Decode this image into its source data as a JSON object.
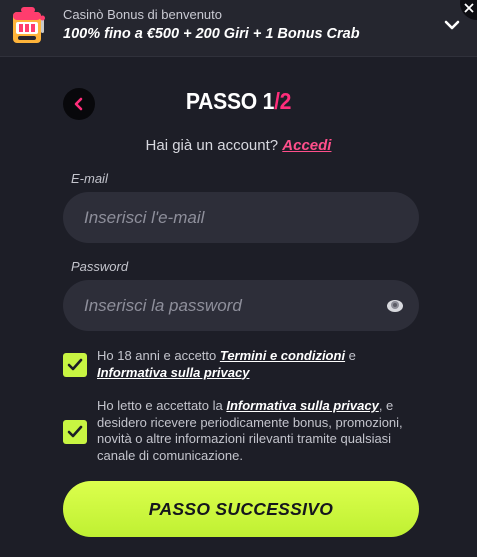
{
  "banner": {
    "subtitle": "Casinò Bonus di benvenuto",
    "title": "100% fino a €500 + 200 Giri + 1 Bonus Crab"
  },
  "step": {
    "label": "PASSO ",
    "current": "1",
    "total": "/2"
  },
  "login": {
    "prompt": "Hai già un account? ",
    "link": "Accedi"
  },
  "email": {
    "label": "E-mail",
    "placeholder": "Inserisci l'e-mail"
  },
  "password": {
    "label": "Password",
    "placeholder": "Inserisci la password"
  },
  "terms": {
    "checked": true,
    "text_before": "Ho 18 anni e accetto ",
    "link1": "Termini e condizioni",
    "text_mid": " e ",
    "link2": "Informativa sulla privacy"
  },
  "marketing": {
    "checked": true,
    "text_before": "Ho letto e accettato la ",
    "link": "Informativa sulla privacy",
    "text_after": ", e desidero ricevere periodicamente bonus, promozioni, novità o altre informazioni rilevanti tramite qualsiasi canale di comunicazione."
  },
  "next_button": {
    "label": "PASSO SUCCESSIVO"
  },
  "colors": {
    "background": "#1d1e27",
    "accent_pink": "#ff2d7a",
    "accent_lime": "#c8f542",
    "field": "#2d2e39"
  },
  "icons": [
    "slot-machine-icon",
    "chevron-down-icon",
    "close-icon",
    "back-arrow-icon",
    "eye-icon",
    "checkmark-icon"
  ]
}
